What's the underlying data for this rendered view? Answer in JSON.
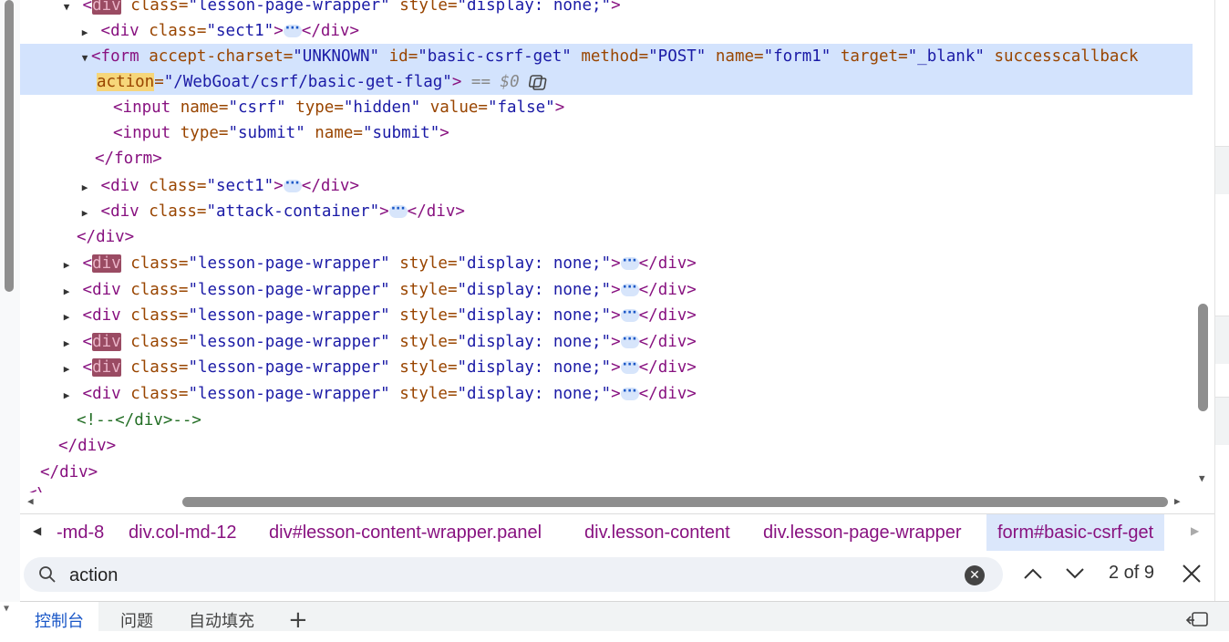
{
  "tree": {
    "line0": {
      "tag_open": "<",
      "hl": "div",
      "attr1": " class=",
      "val1": "\"lesson-page-wrapper\"",
      "attr2": " style=",
      "val2": "\"display: none;\"",
      "close": ">"
    },
    "line1": {
      "open": "<div",
      "attr": " class=",
      "val": "\"sect1\"",
      "close": ">",
      "end": "</div>"
    },
    "line2": {
      "open": "<form",
      "attr1": " accept-charset=",
      "val1": "\"UNKNOWN\"",
      "attr2": " id=",
      "val2": "\"basic-csrf-get\"",
      "attr3": " method=",
      "val3": "\"POST\"",
      "attr4": " name=",
      "val4": "\"form1\"",
      "attr5": " target=",
      "val5": "\"_blank\"",
      "attr6": " successcallback",
      "attr7": "action",
      "eq7": "=",
      "val7": "\"/WebGoat/csrf/basic-get-flag\"",
      "close": ">",
      "dollar": " == $0"
    },
    "line3": {
      "open": "<input",
      "attr1": " name=",
      "val1": "\"csrf\"",
      "attr2": " type=",
      "val2": "\"hidden\"",
      "attr3": " value=",
      "val3": "\"false\"",
      "close": ">"
    },
    "line4": {
      "open": "<input",
      "attr1": " type=",
      "val1": "\"submit\"",
      "attr2": " name=",
      "val2": "\"submit\"",
      "close": ">"
    },
    "line5": {
      "text": "</form>"
    },
    "line6": {
      "open": "<div",
      "attr": " class=",
      "val": "\"sect1\"",
      "close": ">",
      "end": "</div>"
    },
    "line7": {
      "open": "<div",
      "attr": " class=",
      "val": "\"attack-container\"",
      "close": ">",
      "end": "</div>"
    },
    "line8": {
      "text": "</div>"
    },
    "wrappers": [
      {
        "lt": "<",
        "hl": "div",
        "plain": "",
        "attr1": " class=",
        "val1": "\"lesson-page-wrapper\"",
        "attr2": " style=",
        "val2": "\"display: none;\"",
        "close": ">",
        "end": "</div>"
      },
      {
        "lt": "<",
        "hl": "",
        "plain": "div",
        "attr1": " class=",
        "val1": "\"lesson-page-wrapper\"",
        "attr2": " style=",
        "val2": "\"display: none;\"",
        "close": ">",
        "end": "</div>"
      },
      {
        "lt": "<",
        "hl": "",
        "plain": "div",
        "attr1": " class=",
        "val1": "\"lesson-page-wrapper\"",
        "attr2": " style=",
        "val2": "\"display: none;\"",
        "close": ">",
        "end": "</div>"
      },
      {
        "lt": "<",
        "hl": "div",
        "plain": "",
        "attr1": " class=",
        "val1": "\"lesson-page-wrapper\"",
        "attr2": " style=",
        "val2": "\"display: none;\"",
        "close": ">",
        "end": "</div>"
      },
      {
        "lt": "<",
        "hl": "div",
        "plain": "",
        "attr1": " class=",
        "val1": "\"lesson-page-wrapper\"",
        "attr2": " style=",
        "val2": "\"display: none;\"",
        "close": ">",
        "end": "</div>"
      },
      {
        "lt": "<",
        "hl": "",
        "plain": "div",
        "attr1": " class=",
        "val1": "\"lesson-page-wrapper\"",
        "attr2": " style=",
        "val2": "\"display: none;\"",
        "close": ">",
        "end": "</div>"
      }
    ],
    "comment": "<!--</div>-->",
    "close1": "</div>",
    "close2": "</div>",
    "clipped": "<\\..."
  },
  "breadcrumb": {
    "items": [
      "-md-8",
      "div.col-md-12",
      "div#lesson-content-wrapper.panel",
      "div.lesson-content",
      "div.lesson-page-wrapper",
      "form#basic-csrf-get"
    ]
  },
  "search": {
    "value": "action",
    "match_count": "2 of 9"
  },
  "drawer": {
    "tabs": [
      "控制台",
      "问题",
      "自动填充"
    ],
    "add": "+"
  }
}
